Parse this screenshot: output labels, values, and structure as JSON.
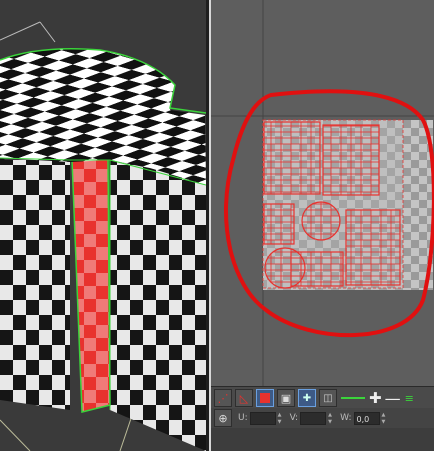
{
  "viewport": {
    "object": "checkered-cylinder",
    "selected_faces": "uv-seam-strip",
    "colors": {
      "selection": "#e8322e",
      "wire": "#3bd43b"
    }
  },
  "uv_editor": {
    "checker_texture": "checker-map",
    "selection_color": "#e8322e",
    "highlight_loop_color": "#e01010"
  },
  "toolbar": {
    "row1_icons": [
      "move-vertex-icon",
      "freeform-icon",
      "select-face-icon",
      "render-template-icon",
      "add-modifier-icon",
      "relax-icon",
      "dash-line-icon",
      "plus-icon",
      "minus-icon",
      "stack-icon"
    ],
    "row2": {
      "transform_icon": "transform-gizmo-icon",
      "u_label": "U:",
      "u_value": "",
      "v_label": "V:",
      "v_value": "",
      "w_label": "W:",
      "w_value": "0,0"
    }
  }
}
